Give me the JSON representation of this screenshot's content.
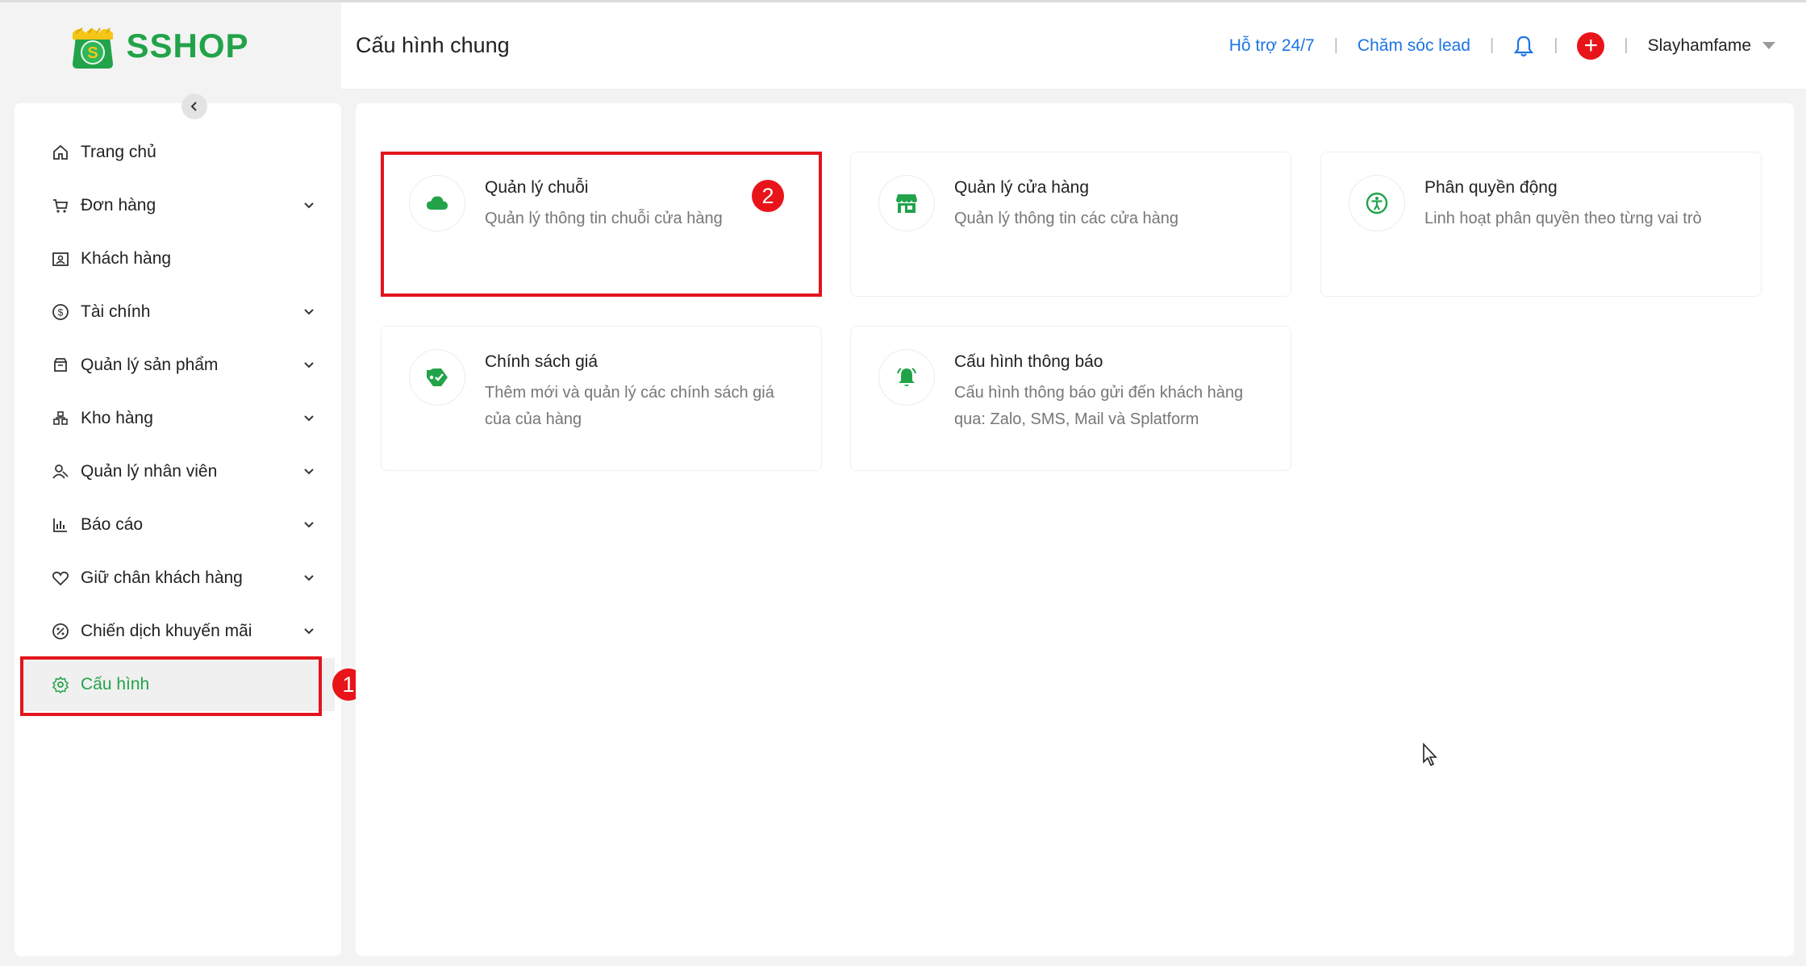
{
  "brand": {
    "name": "SSHOP"
  },
  "header": {
    "title": "Cấu hình chung",
    "support_link": "Hỗ trợ 24/7",
    "lead_link": "Chăm sóc lead",
    "user_name": "Slayhamfame"
  },
  "sidebar": {
    "items": [
      {
        "label": "Trang chủ",
        "icon": "home-icon",
        "has_submenu": false
      },
      {
        "label": "Đơn hàng",
        "icon": "cart-icon",
        "has_submenu": true
      },
      {
        "label": "Khách hàng",
        "icon": "customer-card-icon",
        "has_submenu": false
      },
      {
        "label": "Tài chính",
        "icon": "dollar-circle-icon",
        "has_submenu": true
      },
      {
        "label": "Quản lý sản phẩm",
        "icon": "product-box-icon",
        "has_submenu": true
      },
      {
        "label": "Kho hàng",
        "icon": "warehouse-icon",
        "has_submenu": true
      },
      {
        "label": "Quản lý nhân viên",
        "icon": "staff-icon",
        "has_submenu": true
      },
      {
        "label": "Báo cáo",
        "icon": "bar-chart-icon",
        "has_submenu": true
      },
      {
        "label": "Giữ chân khách hàng",
        "icon": "heart-icon",
        "has_submenu": true
      },
      {
        "label": "Chiến dịch khuyến mãi",
        "icon": "discount-icon",
        "has_submenu": true
      },
      {
        "label": "Cấu hình",
        "icon": "gear-icon",
        "has_submenu": false,
        "active": true
      }
    ]
  },
  "annotations": {
    "step1": "1",
    "step2": "2"
  },
  "cards": [
    {
      "title": "Quản lý chuỗi",
      "desc": "Quản lý thông tin chuỗi cửa hàng",
      "icon": "cloud-icon"
    },
    {
      "title": "Quản lý cửa hàng",
      "desc": "Quản lý thông tin các cửa hàng",
      "icon": "store-icon"
    },
    {
      "title": "Phân quyền động",
      "desc": "Linh hoạt phân quyền theo từng vai trò",
      "icon": "accessibility-icon"
    },
    {
      "title": "Chính sách giá",
      "desc": "Thêm mới và quản lý các chính sách giá của của hàng",
      "icon": "price-tag-icon"
    },
    {
      "title": "Cấu hình thông báo",
      "desc": "Cấu hình thông báo gửi đến khách hàng qua: Zalo, SMS, Mail và Splatform",
      "icon": "notification-bell-icon"
    }
  ],
  "colors": {
    "brand_green": "#22a34a",
    "link_blue": "#1b74e4",
    "highlight_red": "#e3141c"
  }
}
